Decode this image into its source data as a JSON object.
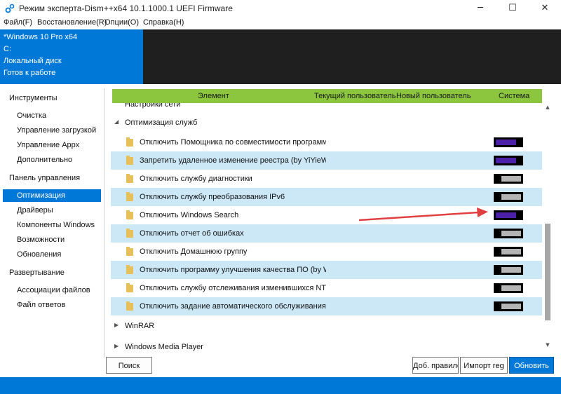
{
  "window": {
    "title": "Режим эксперта-Dism++x64 10.1.1000.1 UEFI Firmware",
    "minimize": "─",
    "maximize": "☐",
    "close": "✕"
  },
  "menu": [
    "Файл(F)",
    "Восстановление(R)",
    "Опции(O)",
    "Справка(H)"
  ],
  "info": {
    "os": "*Windows 10 Pro x64",
    "drive": "C:",
    "disk": "Локальный диск",
    "status": "Готов к работе"
  },
  "sidebar": {
    "sections": [
      {
        "title": "Инструменты",
        "items": [
          "Очистка",
          "Управление загрузкой",
          "Управление Appx",
          "Дополнительно"
        ]
      },
      {
        "title": "Панель управления",
        "items": [
          "Оптимизация",
          "Драйверы",
          "Компоненты Windows",
          "Возможности",
          "Обновления"
        ]
      },
      {
        "title": "Развертывание",
        "items": [
          "Ассоциации файлов",
          "Файл ответов"
        ]
      }
    ],
    "active": "Оптимизация"
  },
  "table": {
    "columns": [
      "Элемент",
      "Текущий пользователь",
      "Новый пользователь",
      "Система"
    ],
    "partial_group": "Настройки сети",
    "group": "Оптимизация служб",
    "rows": [
      {
        "label": "Отключить Помощника по совместимости программ (...",
        "state": "on"
      },
      {
        "label": "Запретить удаленное изменение реестра (by YiYieWeiFe...",
        "state": "on"
      },
      {
        "label": "Отключить службу диагностики",
        "state": "off"
      },
      {
        "label": "Отключить службу преобразования IPv6",
        "state": "off"
      },
      {
        "label": "Отключить Windows Search",
        "state": "on"
      },
      {
        "label": "Отключить отчет об ошибках",
        "state": "off"
      },
      {
        "label": "Отключить Домашнюю группу",
        "state": "off"
      },
      {
        "label": "Отключить программу улучшения качества ПО (by Wi...",
        "state": "off"
      },
      {
        "label": "Отключить службу отслеживания изменившихся NTFS-...",
        "state": "off"
      },
      {
        "label": "Отключить задание автоматического обслуживания (b...",
        "state": "off"
      }
    ],
    "collapsed_groups": [
      "WinRAR",
      "Windows Media Player"
    ]
  },
  "buttons": {
    "search": "Поиск",
    "add_rules": "Доб. правило",
    "import_reg": "Импорт reg",
    "update": "Обновить"
  },
  "colors": {
    "accent": "#0078d7",
    "header_green": "#8cc63e",
    "toggle_on": "#4b1fa8",
    "toggle_off": "#b4b4b4",
    "alt_row": "#cce8f7",
    "annotation_arrow": "#e04040"
  },
  "annotation": {
    "points_to": "Отключить Windows Search"
  }
}
